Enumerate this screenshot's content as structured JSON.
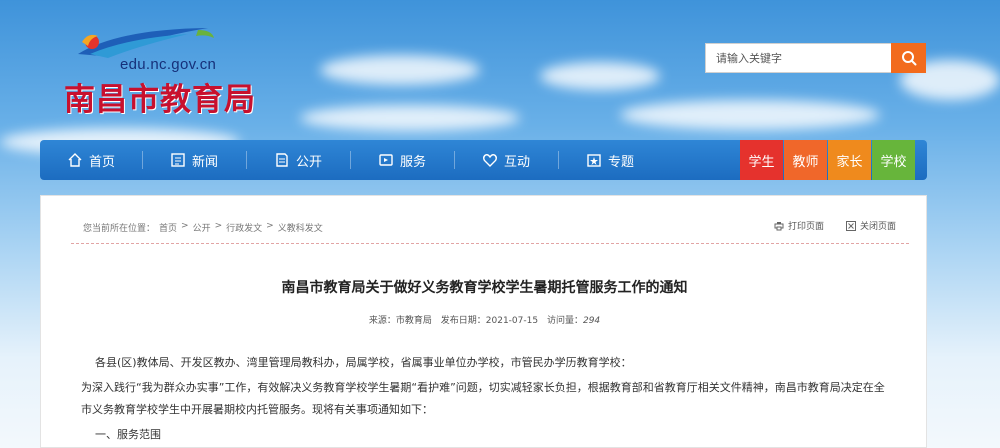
{
  "header": {
    "site_url": "edu.nc.gov.cn",
    "site_name": "南昌市教育局",
    "search_placeholder": "请输入关键字"
  },
  "nav": {
    "items": [
      {
        "label": "首页",
        "icon": "home-icon"
      },
      {
        "label": "新闻",
        "icon": "news-icon"
      },
      {
        "label": "公开",
        "icon": "document-icon"
      },
      {
        "label": "服务",
        "icon": "service-icon"
      },
      {
        "label": "互动",
        "icon": "heart-icon"
      },
      {
        "label": "专题",
        "icon": "topic-icon"
      }
    ],
    "roles": [
      {
        "label": "学生",
        "color": "#e5322d"
      },
      {
        "label": "教师",
        "color": "#f0672a"
      },
      {
        "label": "家长",
        "color": "#ef8a1d"
      },
      {
        "label": "学校",
        "color": "#67b53b"
      }
    ]
  },
  "breadcrumb": {
    "prefix": "您当前所在位置：",
    "items": [
      "首页",
      ">",
      "公开",
      ">",
      "行政发文",
      ">",
      "义教科发文"
    ]
  },
  "tools": {
    "print": "打印页面",
    "close": "关闭页面"
  },
  "article": {
    "title": "南昌市教育局关于做好义务教育学校学生暑期托管服务工作的通知",
    "source_label": "来源：",
    "source": "市教育局",
    "date_label": "发布日期：",
    "date": "2021-07-15",
    "views_label": "访问量：",
    "views": "294",
    "paragraphs": [
      "各县(区)教体局、开发区教办、湾里管理局教科办，局属学校，省属事业单位办学校，市管民办学历教育学校：",
      "为深入践行“我为群众办实事”工作，有效解决义务教育学校学生暑期“看护难”问题，切实减轻家长负担，根据教育部和省教育厅相关文件精神，南昌市教育局决定在全市义务教育学校学生中开展暑期校内托管服务。现将有关事项通知如下：",
      "一、服务范围"
    ]
  },
  "colors": {
    "nav_bg": "#1f72c5",
    "search_button": "#f26b1d",
    "site_name": "#c8102e"
  }
}
